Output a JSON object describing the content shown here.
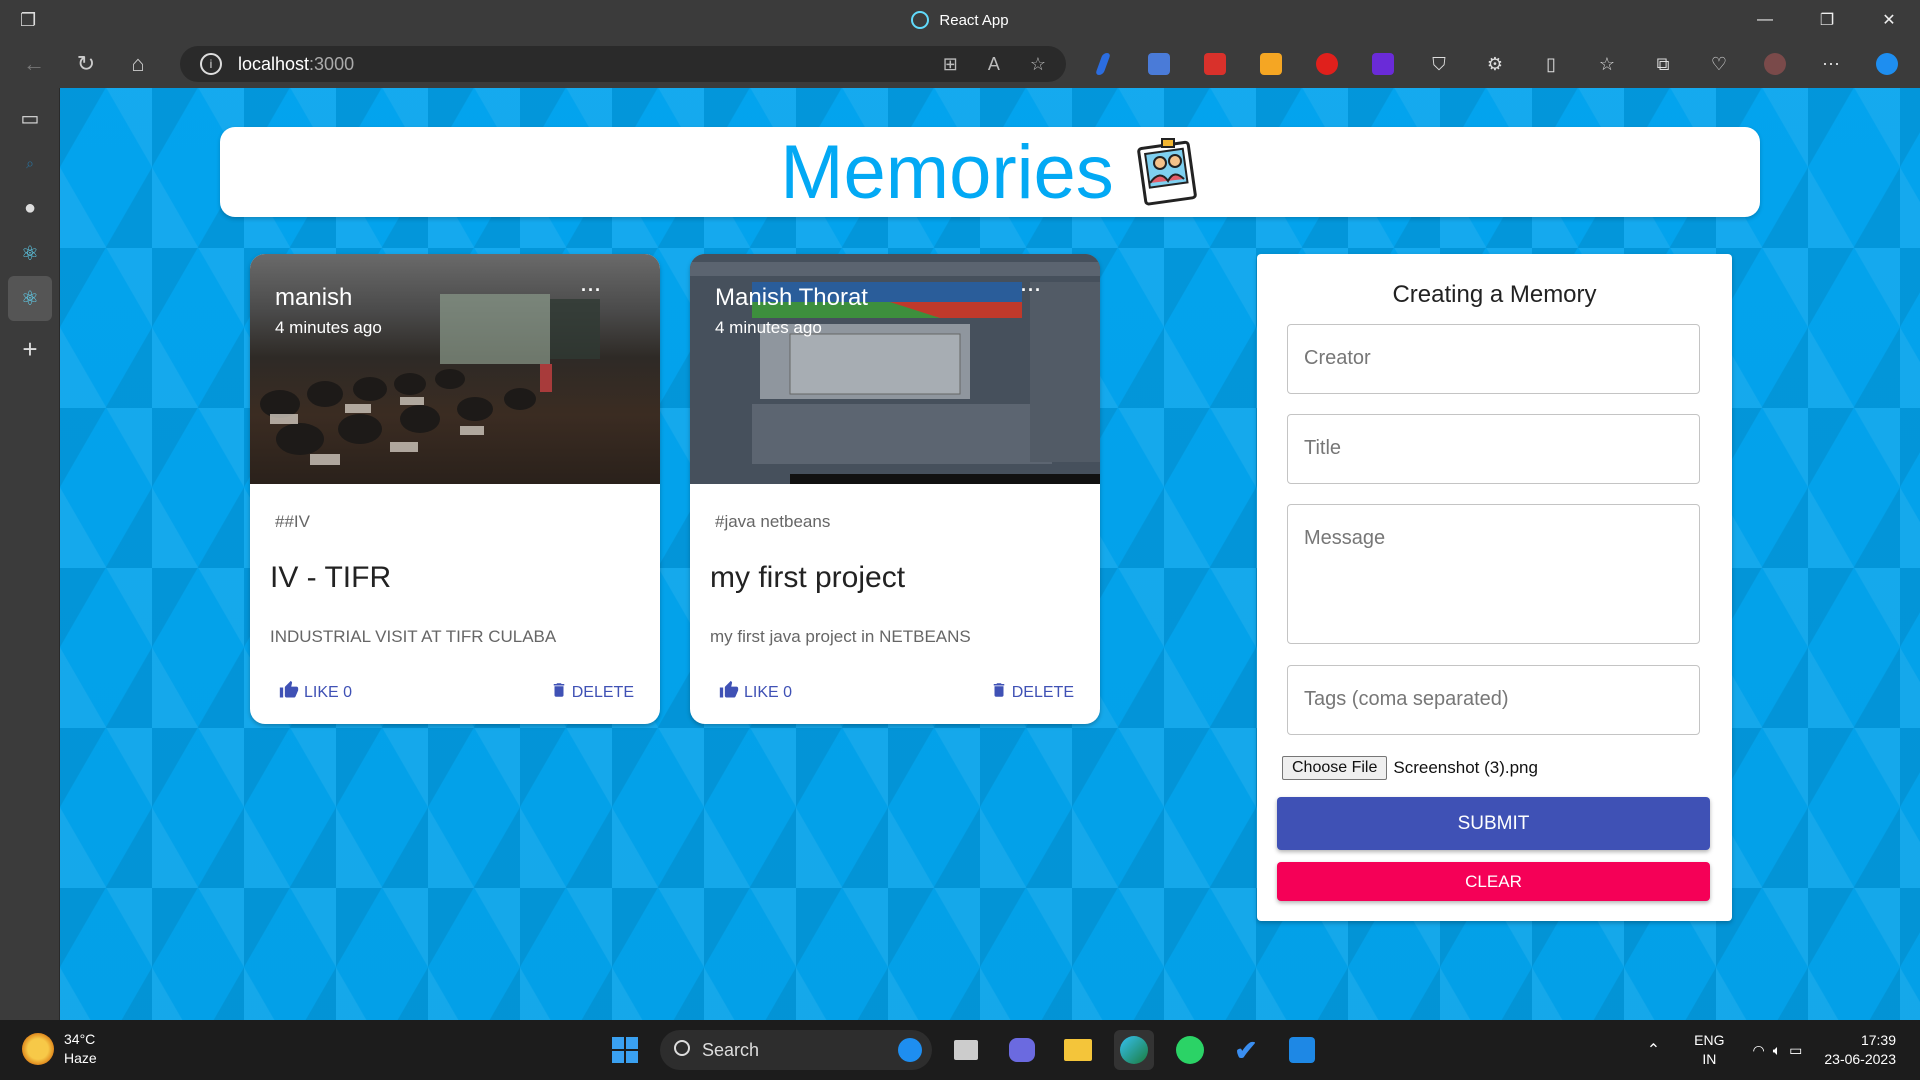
{
  "browser": {
    "window_title": "React App",
    "url_host": "localhost",
    "url_port": ":3000"
  },
  "app": {
    "heading": "Memories"
  },
  "posts": [
    {
      "creator": "manish",
      "time": "4 minutes ago",
      "tags": "##IV",
      "title": "IV - TIFR",
      "message": "INDUSTRIAL VISIT AT TIFR CULABA",
      "like_label": "LIKE 0",
      "delete_label": "DELETE"
    },
    {
      "creator": "Manish Thorat",
      "time": "4 minutes ago",
      "tags": "#java netbeans",
      "title": "my first project",
      "message": "my first java project in NETBEANS",
      "like_label": "LIKE 0",
      "delete_label": "DELETE"
    }
  ],
  "form": {
    "title": "Creating a Memory",
    "creator_placeholder": "Creator",
    "title_placeholder": "Title",
    "message_placeholder": "Message",
    "tags_placeholder": "Tags (coma separated)",
    "file_button": "Choose File",
    "file_name": "Screenshot (3).png",
    "submit_label": "SUBMIT",
    "clear_label": "CLEAR"
  },
  "taskbar": {
    "temperature": "34°C",
    "weather": "Haze",
    "search_label": "Search",
    "lang_1": "ENG",
    "lang_2": "IN",
    "time": "17:39",
    "date": "23-06-2023"
  },
  "colors": {
    "primary": "#3f51b5",
    "secondary": "#f50057",
    "heading": "#03a9f4"
  }
}
